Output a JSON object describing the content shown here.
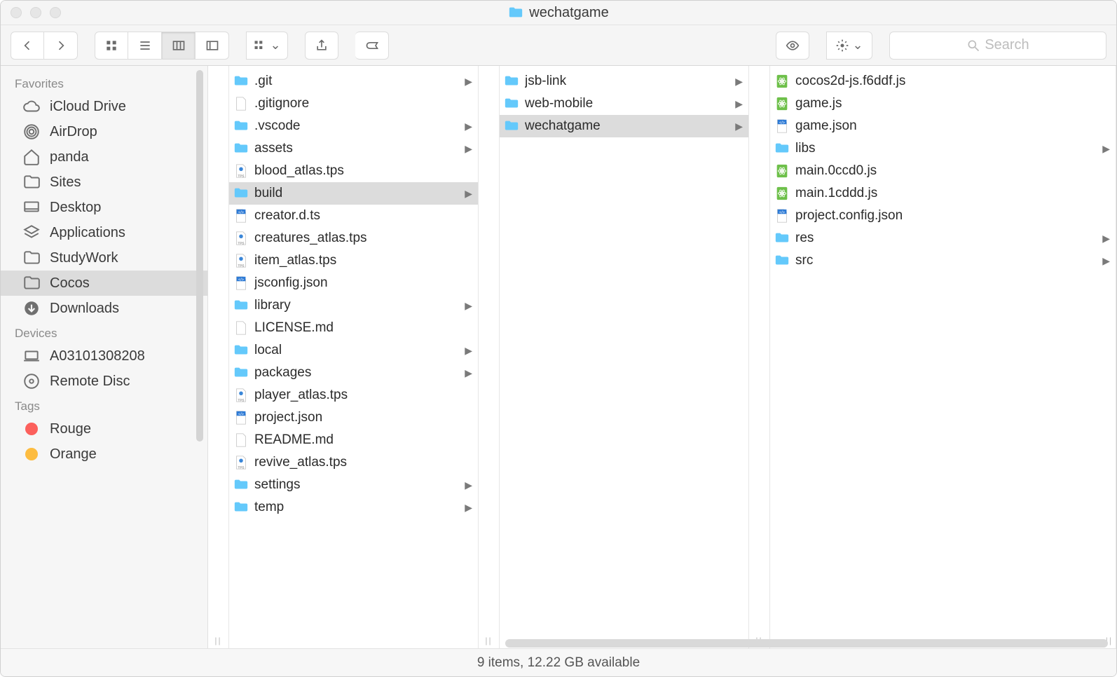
{
  "window": {
    "title": "wechatgame"
  },
  "search": {
    "placeholder": "Search"
  },
  "sidebar": {
    "sections": [
      {
        "title": "Favorites",
        "items": [
          {
            "label": "iCloud Drive",
            "icon": "cloud",
            "selected": false
          },
          {
            "label": "AirDrop",
            "icon": "airdrop",
            "selected": false
          },
          {
            "label": "panda",
            "icon": "home",
            "selected": false
          },
          {
            "label": "Sites",
            "icon": "folder",
            "selected": false
          },
          {
            "label": "Desktop",
            "icon": "desktop",
            "selected": false
          },
          {
            "label": "Applications",
            "icon": "apps",
            "selected": false
          },
          {
            "label": "StudyWork",
            "icon": "folder",
            "selected": false
          },
          {
            "label": "Cocos",
            "icon": "folder",
            "selected": true
          },
          {
            "label": "Downloads",
            "icon": "download",
            "selected": false
          }
        ]
      },
      {
        "title": "Devices",
        "items": [
          {
            "label": "A03101308208",
            "icon": "laptop",
            "selected": false
          },
          {
            "label": "Remote Disc",
            "icon": "disc",
            "selected": false
          }
        ]
      },
      {
        "title": "Tags",
        "items": [
          {
            "label": "Rouge",
            "icon": "tag",
            "color": "#fc605c",
            "selected": false
          },
          {
            "label": "Orange",
            "icon": "tag",
            "color": "#fdbc40",
            "selected": false
          }
        ]
      }
    ]
  },
  "columns": [
    [
      {
        "name": ".git",
        "type": "folder",
        "hasChildren": true,
        "selected": false
      },
      {
        "name": ".gitignore",
        "type": "file",
        "hasChildren": false,
        "selected": false
      },
      {
        "name": ".vscode",
        "type": "folder",
        "hasChildren": true,
        "selected": false
      },
      {
        "name": "assets",
        "type": "folder",
        "hasChildren": true,
        "selected": false
      },
      {
        "name": "blood_atlas.tps",
        "type": "tps",
        "hasChildren": false,
        "selected": false
      },
      {
        "name": "build",
        "type": "folder",
        "hasChildren": true,
        "selected": true
      },
      {
        "name": "creator.d.ts",
        "type": "code",
        "hasChildren": false,
        "selected": false
      },
      {
        "name": "creatures_atlas.tps",
        "type": "tps",
        "hasChildren": false,
        "selected": false
      },
      {
        "name": "item_atlas.tps",
        "type": "tps",
        "hasChildren": false,
        "selected": false
      },
      {
        "name": "jsconfig.json",
        "type": "code",
        "hasChildren": false,
        "selected": false
      },
      {
        "name": "library",
        "type": "folder",
        "hasChildren": true,
        "selected": false
      },
      {
        "name": "LICENSE.md",
        "type": "file",
        "hasChildren": false,
        "selected": false
      },
      {
        "name": "local",
        "type": "folder",
        "hasChildren": true,
        "selected": false
      },
      {
        "name": "packages",
        "type": "folder",
        "hasChildren": true,
        "selected": false
      },
      {
        "name": "player_atlas.tps",
        "type": "tps",
        "hasChildren": false,
        "selected": false
      },
      {
        "name": "project.json",
        "type": "code",
        "hasChildren": false,
        "selected": false
      },
      {
        "name": "README.md",
        "type": "file",
        "hasChildren": false,
        "selected": false
      },
      {
        "name": "revive_atlas.tps",
        "type": "tps",
        "hasChildren": false,
        "selected": false
      },
      {
        "name": "settings",
        "type": "folder",
        "hasChildren": true,
        "selected": false
      },
      {
        "name": "temp",
        "type": "folder",
        "hasChildren": true,
        "selected": false
      }
    ],
    [
      {
        "name": "jsb-link",
        "type": "folder",
        "hasChildren": true,
        "selected": false
      },
      {
        "name": "web-mobile",
        "type": "folder",
        "hasChildren": true,
        "selected": false
      },
      {
        "name": "wechatgame",
        "type": "folder",
        "hasChildren": true,
        "selected": true
      }
    ],
    [
      {
        "name": "cocos2d-js.f6ddf.js",
        "type": "atom",
        "hasChildren": false,
        "selected": false
      },
      {
        "name": "game.js",
        "type": "atom",
        "hasChildren": false,
        "selected": false
      },
      {
        "name": "game.json",
        "type": "code",
        "hasChildren": false,
        "selected": false
      },
      {
        "name": "libs",
        "type": "folder",
        "hasChildren": true,
        "selected": false
      },
      {
        "name": "main.0ccd0.js",
        "type": "atom",
        "hasChildren": false,
        "selected": false
      },
      {
        "name": "main.1cddd.js",
        "type": "atom",
        "hasChildren": false,
        "selected": false
      },
      {
        "name": "project.config.json",
        "type": "code",
        "hasChildren": false,
        "selected": false
      },
      {
        "name": "res",
        "type": "folder",
        "hasChildren": true,
        "selected": false
      },
      {
        "name": "src",
        "type": "folder",
        "hasChildren": true,
        "selected": false
      }
    ]
  ],
  "status": {
    "text": "9 items, 12.22 GB available"
  }
}
